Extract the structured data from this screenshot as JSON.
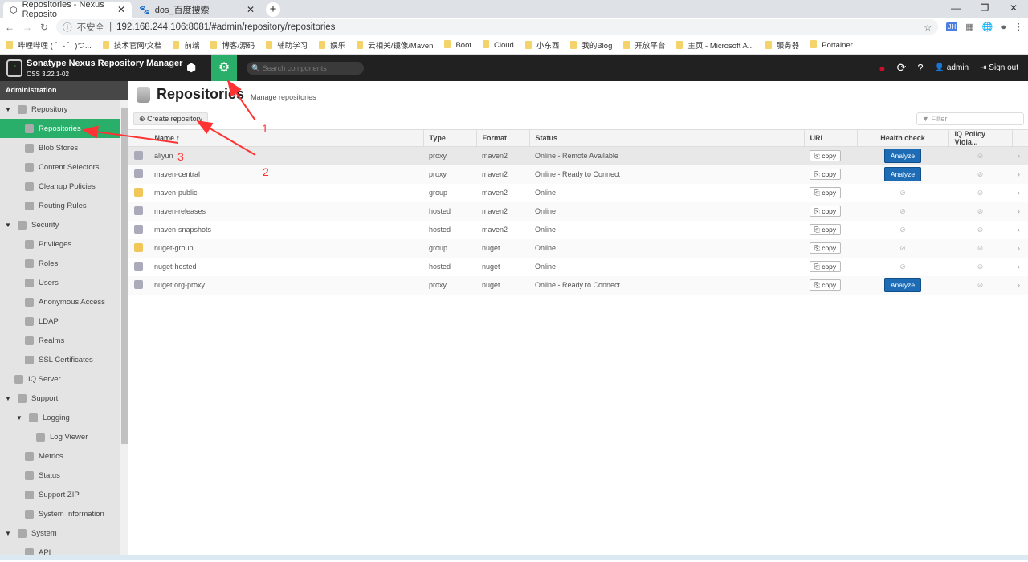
{
  "browser": {
    "tabs": [
      {
        "title": "Repositories - Nexus Reposito"
      },
      {
        "title": "dos_百度搜索"
      }
    ],
    "security": "不安全",
    "url": "192.168.244.106:8081/#admin/repository/repositories",
    "bookmarks": [
      "哔哩哔哩 ( ゜- ゜)つ...",
      "技术官网/文档",
      "前端",
      "博客/源码",
      "辅助学习",
      "娱乐",
      "云相关/镜像/Maven",
      "Boot",
      "Cloud",
      "小东西",
      "我的Blog",
      "开放平台",
      "主页 - Microsoft A...",
      "服务器",
      "Portainer"
    ]
  },
  "header": {
    "brand": "Sonatype Nexus Repository Manager",
    "version": "OSS 3.22.1-02",
    "search_placeholder": "Search components",
    "user": "admin",
    "signout": "Sign out"
  },
  "sidebar": {
    "title": "Administration",
    "items": [
      {
        "label": "Repository",
        "level": 0,
        "tri": "▼"
      },
      {
        "label": "Repositories",
        "level": 1,
        "selected": true
      },
      {
        "label": "Blob Stores",
        "level": 1
      },
      {
        "label": "Content Selectors",
        "level": 1
      },
      {
        "label": "Cleanup Policies",
        "level": 1
      },
      {
        "label": "Routing Rules",
        "level": 1
      },
      {
        "label": "Security",
        "level": 0,
        "tri": "▼"
      },
      {
        "label": "Privileges",
        "level": 1
      },
      {
        "label": "Roles",
        "level": 1
      },
      {
        "label": "Users",
        "level": 1
      },
      {
        "label": "Anonymous Access",
        "level": 1
      },
      {
        "label": "LDAP",
        "level": 1
      },
      {
        "label": "Realms",
        "level": 1
      },
      {
        "label": "SSL Certificates",
        "level": 1
      },
      {
        "label": "IQ Server",
        "level": 0.5
      },
      {
        "label": "Support",
        "level": 0,
        "tri": "▼"
      },
      {
        "label": "Logging",
        "level": 1,
        "tri": "▼"
      },
      {
        "label": "Log Viewer",
        "level": 2
      },
      {
        "label": "Metrics",
        "level": 1
      },
      {
        "label": "Status",
        "level": 1
      },
      {
        "label": "Support ZIP",
        "level": 1
      },
      {
        "label": "System Information",
        "level": 1
      },
      {
        "label": "System",
        "level": 0,
        "tri": "▼"
      },
      {
        "label": "API",
        "level": 1
      }
    ]
  },
  "page": {
    "title": "Repositories",
    "subtitle": "Manage repositories",
    "create": "Create repository",
    "filter_placeholder": "Filter",
    "columns": [
      "Name ↑",
      "Type",
      "Format",
      "Status",
      "URL",
      "Health check",
      "IQ Policy Viola..."
    ],
    "copy_label": "copy",
    "analyze_label": "Analyze",
    "rows": [
      {
        "name": "aliyun",
        "type": "proxy",
        "format": "maven2",
        "status": "Online - Remote Available",
        "analyze": true
      },
      {
        "name": "maven-central",
        "type": "proxy",
        "format": "maven2",
        "status": "Online - Ready to Connect",
        "analyze": true
      },
      {
        "name": "maven-public",
        "type": "group",
        "format": "maven2",
        "status": "Online",
        "analyze": false
      },
      {
        "name": "maven-releases",
        "type": "hosted",
        "format": "maven2",
        "status": "Online",
        "analyze": false
      },
      {
        "name": "maven-snapshots",
        "type": "hosted",
        "format": "maven2",
        "status": "Online",
        "analyze": false
      },
      {
        "name": "nuget-group",
        "type": "group",
        "format": "nuget",
        "status": "Online",
        "analyze": false
      },
      {
        "name": "nuget-hosted",
        "type": "hosted",
        "format": "nuget",
        "status": "Online",
        "analyze": false
      },
      {
        "name": "nuget.org-proxy",
        "type": "proxy",
        "format": "nuget",
        "status": "Online - Ready to Connect",
        "analyze": true
      }
    ]
  },
  "annotations": [
    "1",
    "2",
    "3"
  ],
  "colors": {
    "accent": "#2aaf6a",
    "analyze": "#1d6cb5",
    "annotation": "#ff3333"
  }
}
